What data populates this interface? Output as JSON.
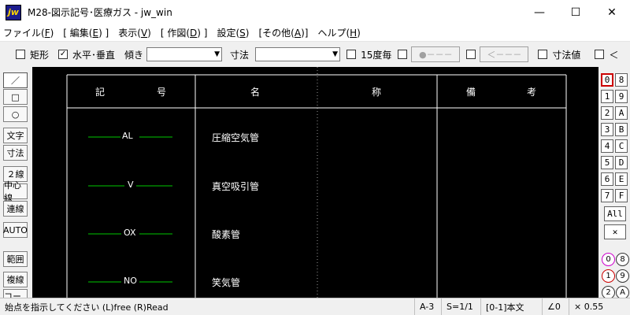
{
  "window": {
    "title": "M28-図示記号･医療ガス - jw_win",
    "icon_text": "jw",
    "minimize": "—",
    "maximize": "☐",
    "close": "✕"
  },
  "menu": [
    {
      "label": "ファイル(",
      "key": "F",
      "tail": ")"
    },
    {
      "label": "[ 編集(",
      "key": "E",
      "tail": ") ]"
    },
    {
      "label": "表示(",
      "key": "V",
      "tail": ")"
    },
    {
      "label": "[ 作図(",
      "key": "D",
      "tail": ") ]"
    },
    {
      "label": "設定(",
      "key": "S",
      "tail": ")"
    },
    {
      "label": "[その他(",
      "key": "A",
      "tail": ")]"
    },
    {
      "label": "ヘルプ(",
      "key": "H",
      "tail": ")"
    }
  ],
  "toolbar": {
    "rect_label": "矩形",
    "hv_label": "水平･垂直",
    "hv_checked": "✓",
    "tilt_label": "傾き",
    "dim_label": "寸法",
    "deg15_label": "15度毎",
    "btn1": "●－－－",
    "btn2": "＜－－－",
    "dimval_label": "寸法値",
    "lt_label": "＜"
  },
  "left_tools": {
    "line": "／",
    "rect": "□",
    "circle": "○",
    "text": "文字",
    "dim": "寸法",
    "double": "２線",
    "center": "中心線",
    "cont": "連線",
    "auto": "AUTO",
    "range": "範囲",
    "copyline": "複線",
    "corner": "コーナ"
  },
  "table": {
    "headers": {
      "symbol1": "記",
      "symbol2": "号",
      "name1": "名",
      "name2": "称",
      "note1": "備",
      "note2": "考"
    },
    "rows": [
      {
        "code": "AL",
        "name": "圧縮空気管"
      },
      {
        "code": "V",
        "name": "真空吸引管"
      },
      {
        "code": "OX",
        "name": "酸素管"
      },
      {
        "code": "NO",
        "name": "笑気管"
      }
    ]
  },
  "right_palette": {
    "layers": [
      "0",
      "8",
      "1",
      "9",
      "2",
      "A",
      "3",
      "B",
      "4",
      "C",
      "5",
      "D",
      "6",
      "E",
      "7",
      "F"
    ],
    "all": "All",
    "x": "✕",
    "groups": [
      "0",
      "8",
      "1",
      "9",
      "2",
      "A"
    ]
  },
  "status": {
    "message": "始点を指示してください (L)free (R)Read",
    "paper": "A-3",
    "scale": "S=1/1",
    "layer": "[0-1]本文",
    "angle": "∠0",
    "factor": "× 0.55"
  },
  "colors": {
    "canvas": "#000000",
    "line_green": "#00c800",
    "table_line": "#ffffff",
    "active_red": "#cc0000"
  }
}
